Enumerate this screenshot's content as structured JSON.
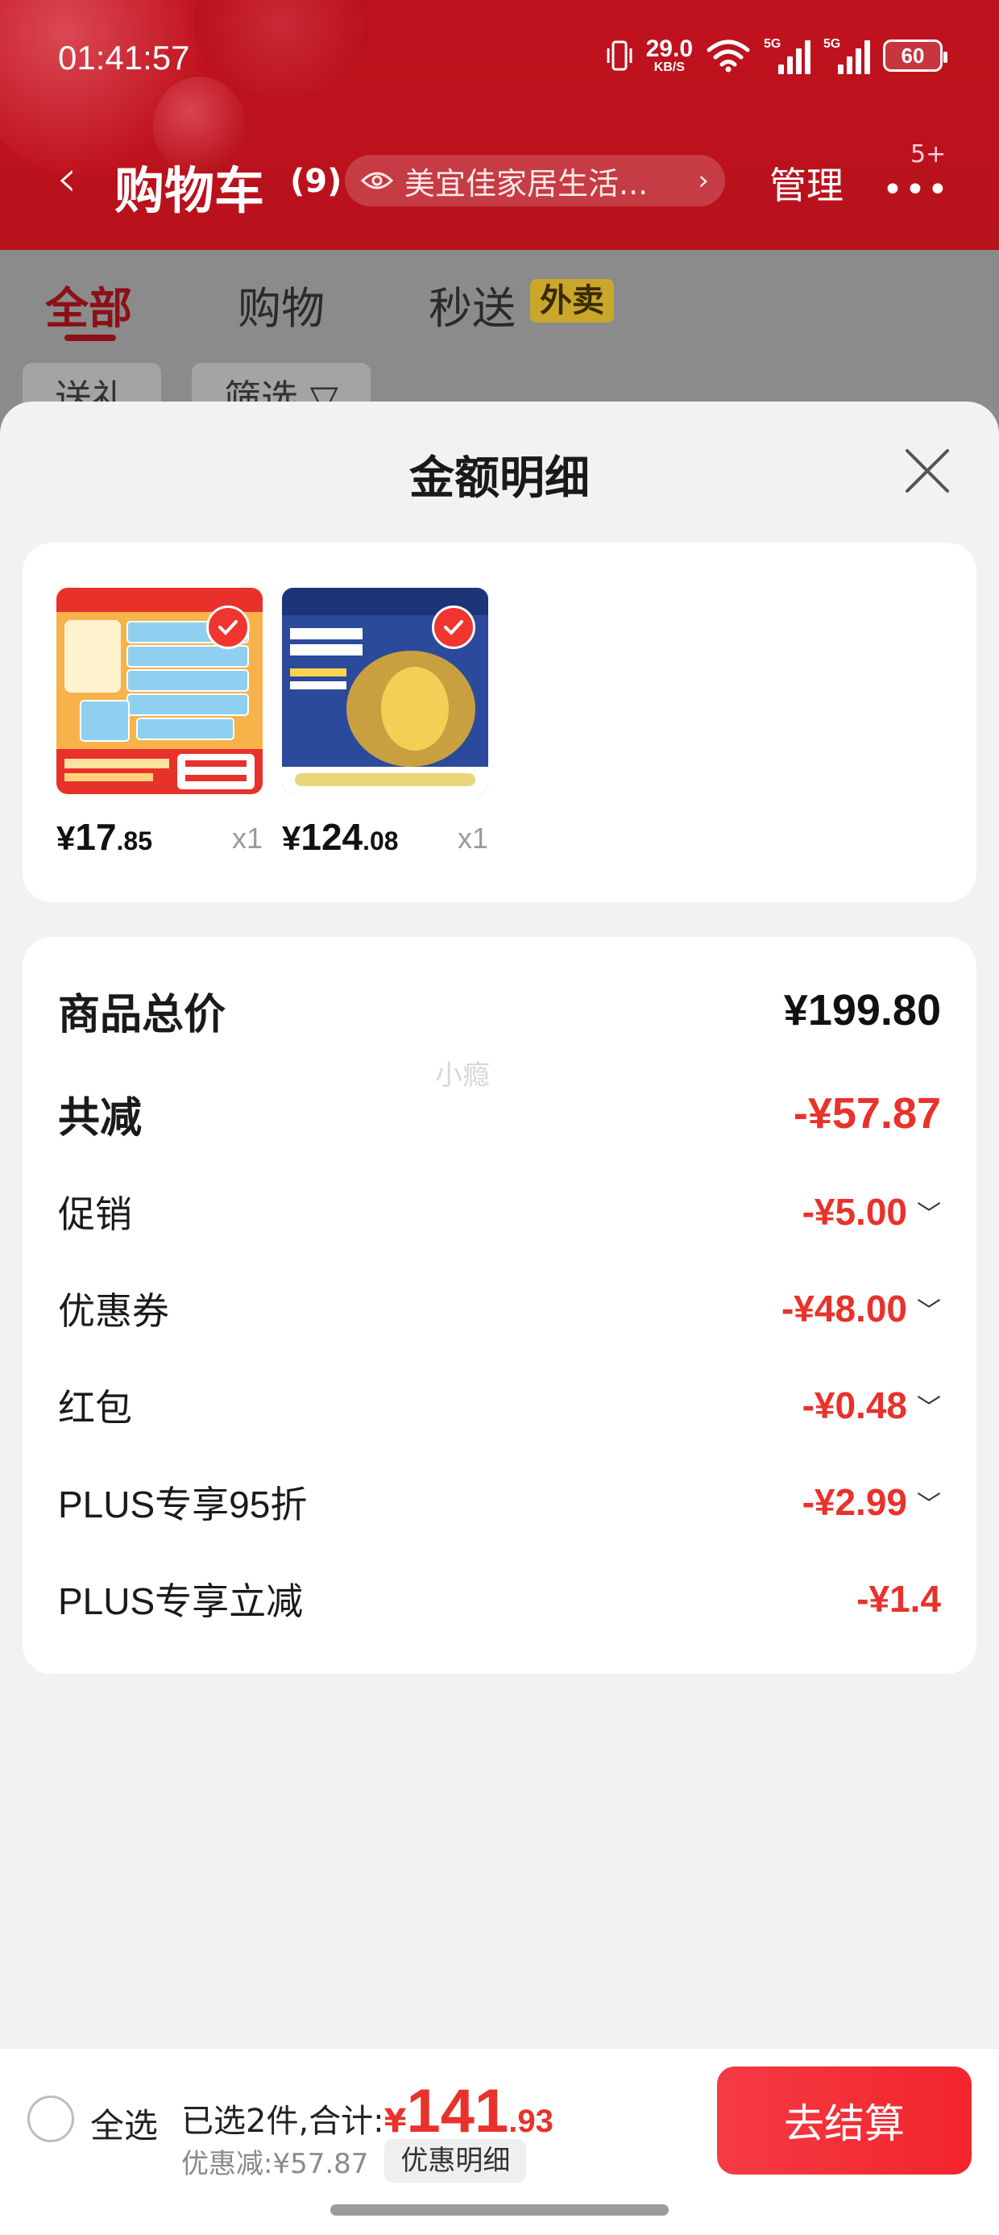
{
  "status_bar": {
    "time": "01:41:57",
    "net_speed": "29.0",
    "net_unit": "KB/S",
    "signal1_label": "5G",
    "signal2_label": "5G",
    "battery": "60"
  },
  "header": {
    "title": "购物车",
    "count": "(9)",
    "store_name": "美宜佳家居生活...",
    "manage_label": "管理",
    "more_badge": "5+"
  },
  "tabs": [
    {
      "label": "全部",
      "active": true
    },
    {
      "label": "购物",
      "active": false
    },
    {
      "label": "秒送",
      "active": false
    }
  ],
  "takeout_badge": "外卖",
  "filter_chips": [
    "送礼",
    "筛选 ▽"
  ],
  "sheet": {
    "title": "金额明细",
    "products": [
      {
        "price_symbol": "¥",
        "price_int": "17",
        "price_dec": ".85",
        "qty": "x1",
        "color": "#f4a03a"
      },
      {
        "price_symbol": "¥",
        "price_int": "124",
        "price_dec": ".08",
        "qty": "x1",
        "color": "#2b4a9c"
      }
    ],
    "rows": [
      {
        "label": "商品总价",
        "value": "¥199.80"
      },
      {
        "label": "共减",
        "value": "-¥57.87"
      },
      {
        "label": "促销",
        "value": "-¥5.00"
      },
      {
        "label": "优惠券",
        "value": "-¥48.00"
      },
      {
        "label": "红包",
        "value": "-¥0.48"
      },
      {
        "label": "PLUS专享95折",
        "value": "-¥2.99"
      },
      {
        "label": "PLUS专享立减",
        "value": "-¥1.4"
      }
    ],
    "watermark": "小瘾"
  },
  "bottom": {
    "select_all": "全选",
    "selected_text": "已选2件,合计:",
    "total_symbol": "¥",
    "total_int": "141",
    "total_dec": ".93",
    "discount_text": "优惠减:¥57.87",
    "detail_button": "优惠明细",
    "checkout_button": "去结算"
  },
  "colors": {
    "brand_red": "#c0121e",
    "accent_red": "#e8322b",
    "checkout": "#f2242c"
  }
}
